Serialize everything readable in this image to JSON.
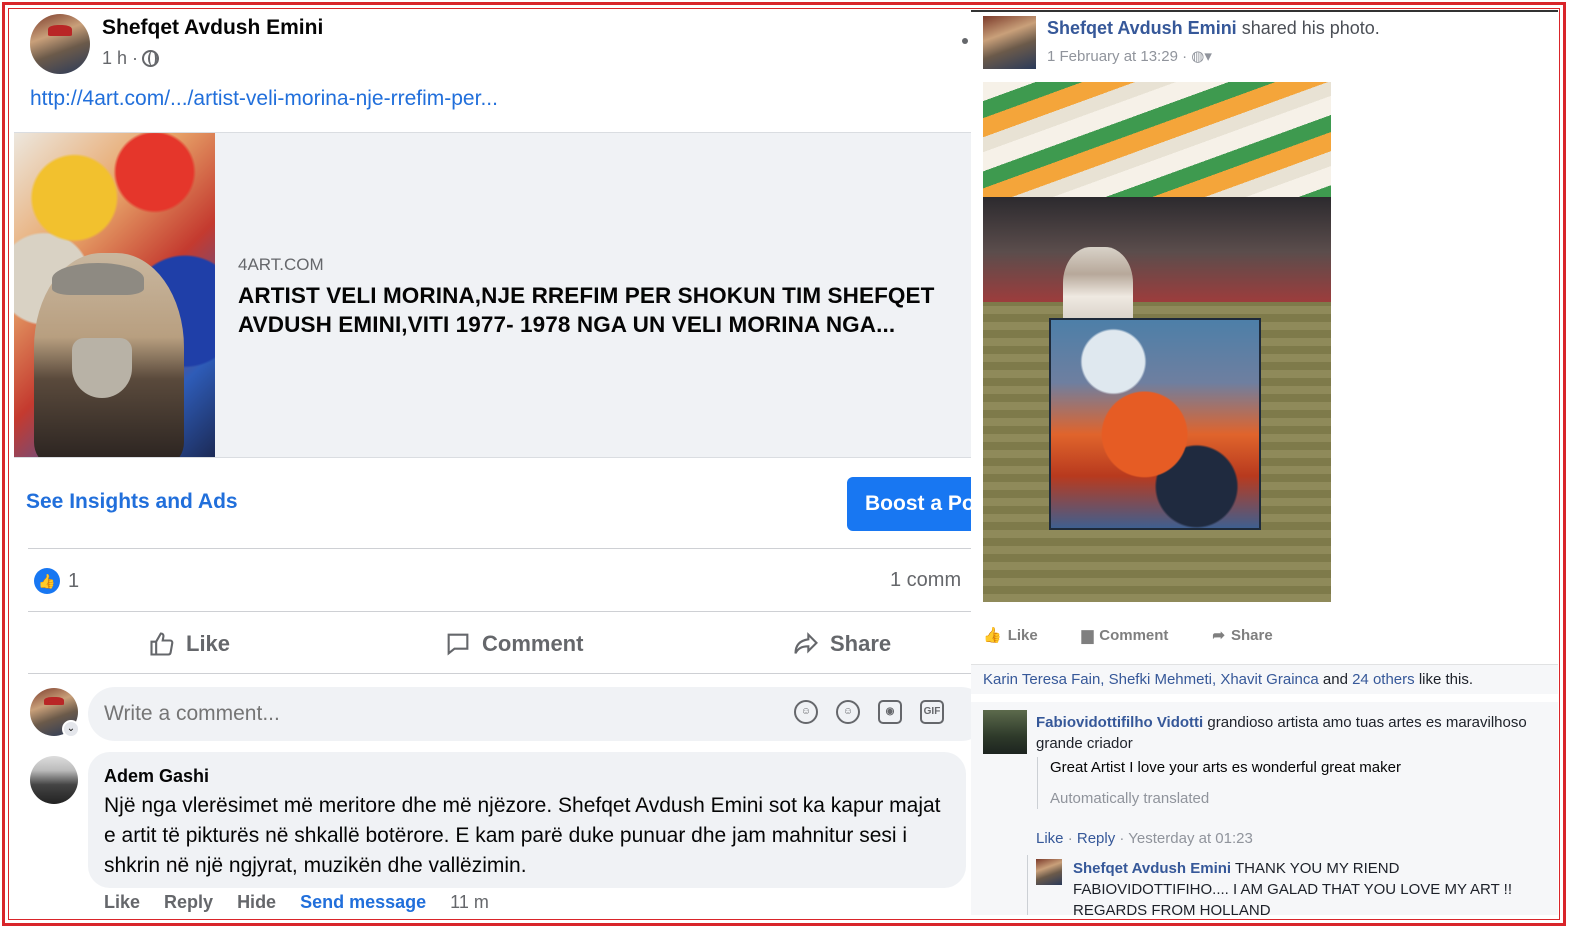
{
  "left_post": {
    "author": "Shefqet Avdush Emini",
    "time": "1 h ·",
    "link_url": "http://4art.com/.../artist-veli-morina-nje-rrefim-per...",
    "link_domain": "4ART.COM",
    "link_title": "ARTIST VELI MORINA,NJE RREFIM PER SHOKUN TIM SHEFQET AVDUSH EMINI,VITI 1977- 1978 NGA UN VELI MORINA NGA...",
    "insights_label": "See Insights and Ads",
    "boost_label": "Boost a Po",
    "like_count": "1",
    "comment_count": "1 comm",
    "actions": {
      "like": "Like",
      "comment": "Comment",
      "share": "Share"
    },
    "composer_placeholder": "Write a comment...",
    "composer_icons": [
      "sticker-icon",
      "emoji-icon",
      "camera-icon",
      "gif-icon"
    ],
    "comment": {
      "author": "Adem Gashi",
      "text": "Një nga vlerësimet më meritore dhe më njëzore. Shefqet Avdush Emini sot ka kapur majat e artit të pikturës në shkallë botërore. E kam parë duke punuar dhe jam mahnitur sesi i shkrin në një ngjyrat, muzikën dhe vallëzimin.",
      "like": "Like",
      "reply": "Reply",
      "hide": "Hide",
      "send_message": "Send message",
      "time": "11 m"
    }
  },
  "right_post": {
    "author": "Shefqet Avdush Emini",
    "shared_text": "shared his photo.",
    "time": "1 February at 13:29 ·",
    "actions": {
      "like": "Like",
      "comment": "Comment",
      "share": "Share"
    },
    "likes_line": {
      "names": "Karin Teresa Fain, Shefki Mehmeti, Xhavit Grainca",
      "and": "and",
      "others": "24 others",
      "suffix": "like this."
    },
    "comment1": {
      "author": "Fabiovidottifilho Vidotti",
      "text": "grandioso artista amo tuas artes es maravilhoso grande criador",
      "translation": "Great Artist I love your arts es wonderful great maker",
      "translated_note": "Automatically translated",
      "like": "Like",
      "reply": "Reply",
      "time": "· Yesterday at 01:23"
    },
    "comment2": {
      "author": "Shefqet Avdush Emini",
      "text": "THANK YOU MY RIEND FABIOVIDOTTIFIHO.... I AM GALAD THAT YOU LOVE MY ART !! REGARDS FROM HOLLAND"
    }
  },
  "colors": {
    "frame": "#d9252a",
    "fb_blue": "#1877f2",
    "link_blue": "#216fdb",
    "classic_blue": "#365899"
  }
}
